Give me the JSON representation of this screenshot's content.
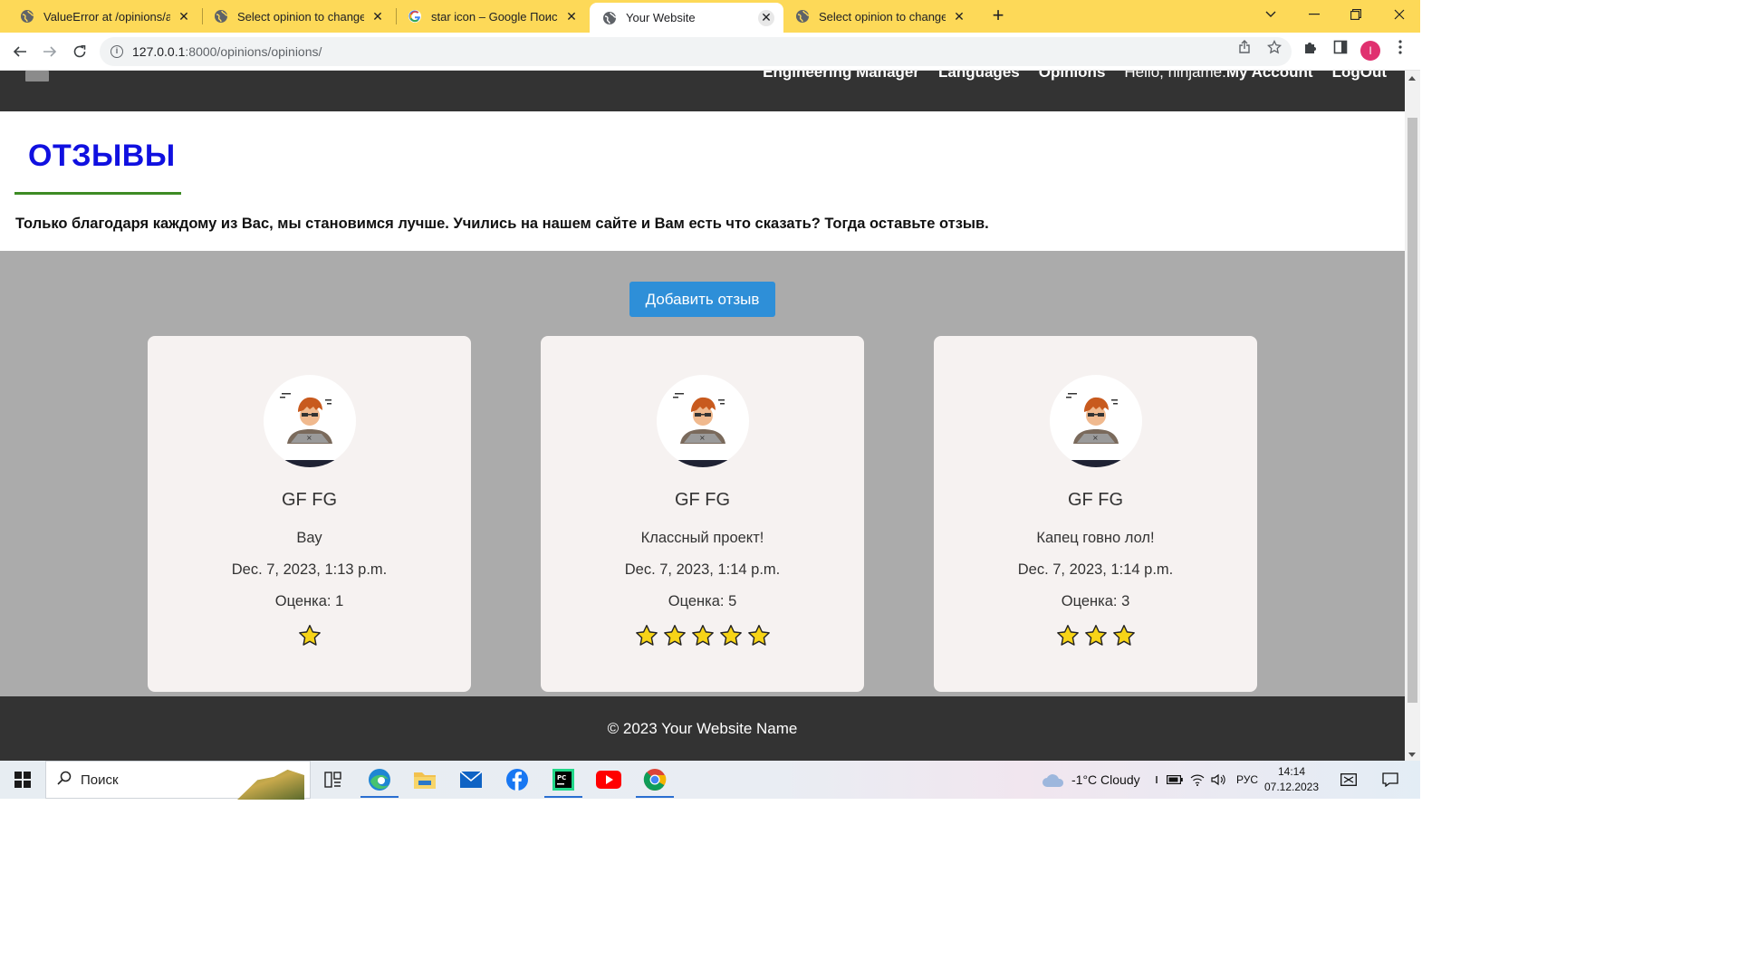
{
  "browser": {
    "tabs": [
      {
        "title": "ValueError at /opinions/ad",
        "active": false,
        "favicon": "globe-icon"
      },
      {
        "title": "Select opinion to change |",
        "active": false,
        "favicon": "globe-icon"
      },
      {
        "title": "star icon – Google Поиск",
        "active": false,
        "favicon": "google-icon"
      },
      {
        "title": "Your Website",
        "active": true,
        "favicon": "globe-icon"
      },
      {
        "title": "Select opinion to change |",
        "active": false,
        "favicon": "globe-icon"
      }
    ],
    "address": {
      "host": "127.0.0.1",
      "path": ":8000/opinions/opinions/"
    },
    "profile_initial": "I",
    "colors": {
      "tab_strip": "#fdd958",
      "profile": "#e0316f"
    }
  },
  "site": {
    "nav": {
      "links": [
        "Engineering Manager",
        "Languages",
        "Opinions"
      ],
      "greeting": "Hello, ninjame.",
      "account": "My Account",
      "logout": "LogOut"
    },
    "page_title": "ОТЗЫВЫ",
    "intro": "Только благодаря каждому из Вас, мы становимся лучше. Учились на нашем сайте и Вам есть что сказать? Тогда оставьте отзыв.",
    "add_button": "Добавить отзыв",
    "reviews": [
      {
        "name": "GF FG",
        "text": "Вау",
        "date": "Dec. 7, 2023, 1:13 p.m.",
        "rating_label": "Оценка: 1",
        "stars": 1
      },
      {
        "name": "GF FG",
        "text": "Классный проект!",
        "date": "Dec. 7, 2023, 1:14 p.m.",
        "rating_label": "Оценка: 5",
        "stars": 5
      },
      {
        "name": "GF FG",
        "text": "Капец говно лол!",
        "date": "Dec. 7, 2023, 1:14 p.m.",
        "rating_label": "Оценка: 3",
        "stars": 3
      }
    ],
    "footer": "© 2023 Your Website Name",
    "colors": {
      "title": "#1010e0",
      "accent_line": "#3d8b24",
      "button": "#2e8fd8",
      "nav": "#333333",
      "section_bg": "#ababab",
      "card_bg": "#f6f2f1",
      "star": "#f7d417"
    }
  },
  "taskbar": {
    "search_placeholder": "Поиск",
    "apps": [
      "task-view-icon",
      "edge-icon",
      "file-explorer-icon",
      "mail-icon",
      "facebook-icon",
      "pycharm-icon",
      "youtube-icon",
      "chrome-icon"
    ],
    "weather": "-1°C  Cloudy",
    "language": "РУС",
    "time": "14:14",
    "date": "07.12.2023"
  }
}
